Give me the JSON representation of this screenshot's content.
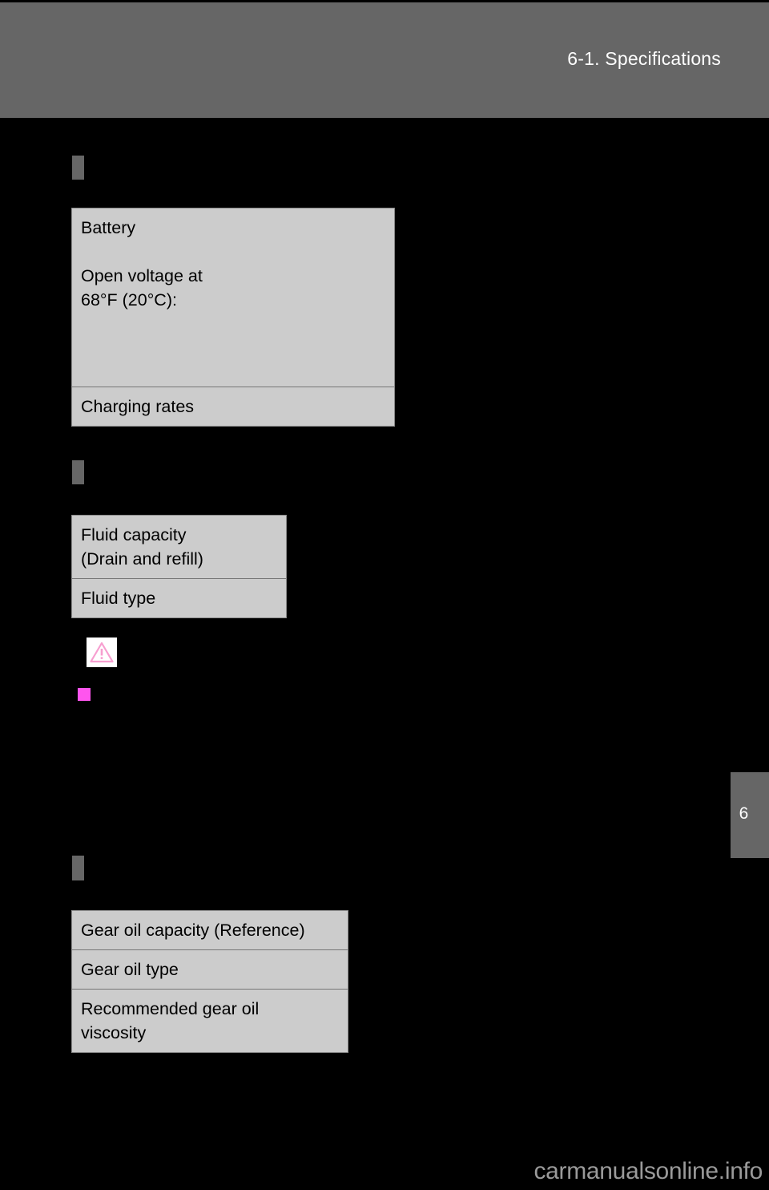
{
  "header": {
    "title": "6-1. Specifications"
  },
  "sections": [
    {
      "marker": "section-marker-battery",
      "table": {
        "name": "battery-specifications-table",
        "rows": [
          {
            "label": "Battery\n\nOpen voltage at\n  68°F (20°C):"
          },
          {
            "label": "Charging rates"
          }
        ]
      }
    },
    {
      "marker": "section-marker-fluid",
      "table": {
        "name": "fluid-specifications-table",
        "rows": [
          {
            "label": "Fluid capacity\n(Drain and refill)"
          },
          {
            "label": "Fluid type"
          }
        ]
      }
    },
    {
      "marker": "section-marker-gear-oil",
      "table": {
        "name": "gear-oil-specifications-table",
        "rows": [
          {
            "label": "Gear oil capacity (Reference)"
          },
          {
            "label": "Gear oil type"
          },
          {
            "label": "Recommended gear oil\nviscosity"
          }
        ]
      }
    }
  ],
  "notice": {
    "warning_icon": "warning-triangle-icon",
    "bullet_icon": "magenta-square-bullet"
  },
  "chapter_tab": {
    "number": "6"
  },
  "watermark": {
    "text": "carmanualsonline.info"
  },
  "colors": {
    "page_background": "#000000",
    "header_bar": "#666666",
    "table_fill": "#cccccc",
    "table_border": "#8a8a8a",
    "accent_magenta": "#ff55ee",
    "watermark_gray": "#9a9a9a"
  }
}
